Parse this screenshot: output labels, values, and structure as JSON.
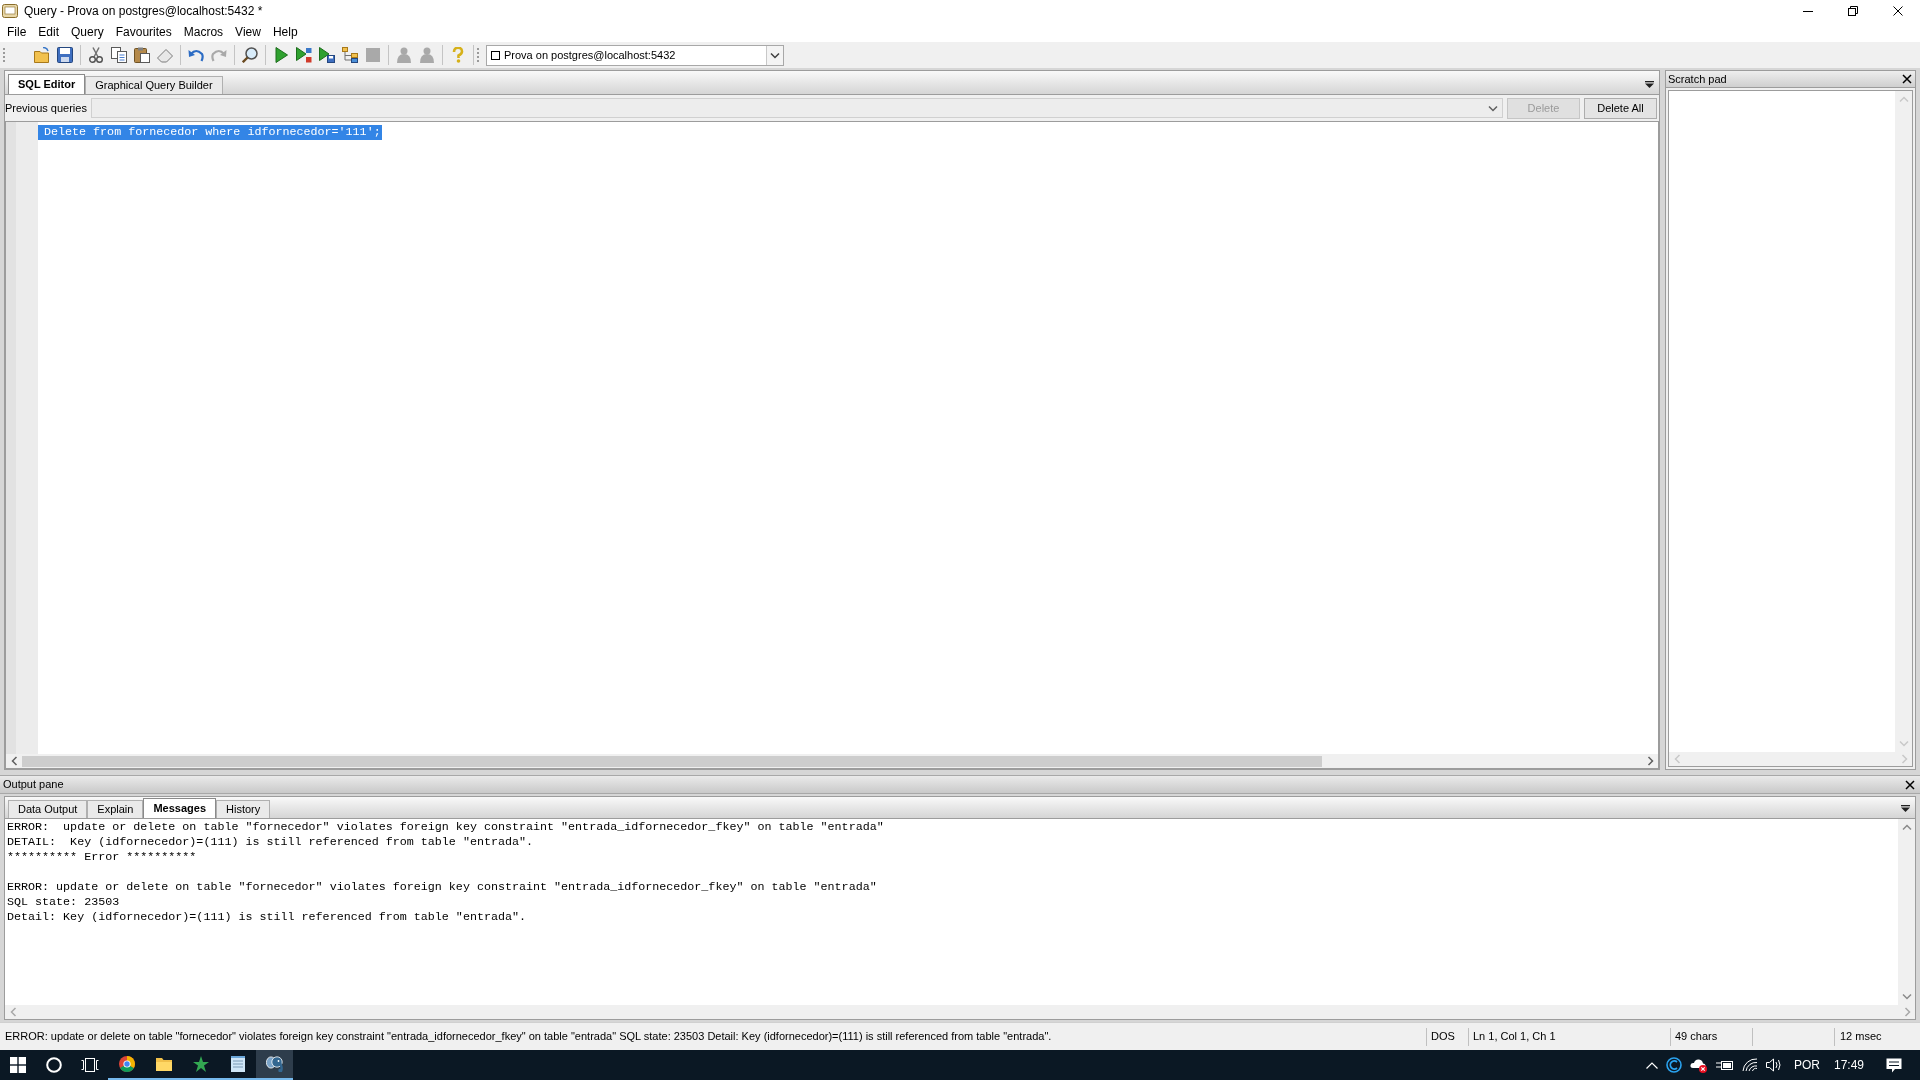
{
  "window": {
    "title": "Query - Prova on postgres@localhost:5432 *"
  },
  "menu": [
    "File",
    "Edit",
    "Query",
    "Favourites",
    "Macros",
    "View",
    "Help"
  ],
  "toolbar": {
    "groups": [
      [
        {
          "kind": "open",
          "disabled": false
        },
        {
          "kind": "save",
          "disabled": false
        }
      ],
      [
        {
          "kind": "cut",
          "disabled": false
        },
        {
          "kind": "copy",
          "disabled": false
        },
        {
          "kind": "paste",
          "disabled": false
        },
        {
          "kind": "clear",
          "disabled": false
        }
      ],
      [
        {
          "kind": "undo",
          "disabled": false
        },
        {
          "kind": "redo",
          "disabled": true
        }
      ],
      [
        {
          "kind": "find",
          "disabled": false
        }
      ],
      [
        {
          "kind": "execute",
          "disabled": false
        },
        {
          "kind": "execute_script",
          "disabled": false
        },
        {
          "kind": "execute_file",
          "disabled": false
        },
        {
          "kind": "explain",
          "disabled": false
        },
        {
          "kind": "stop",
          "disabled": true
        }
      ],
      [
        {
          "kind": "commit",
          "disabled": true
        },
        {
          "kind": "rollback",
          "disabled": true
        }
      ],
      [
        {
          "kind": "help",
          "disabled": false
        }
      ]
    ],
    "connection": "Prova on postgres@localhost:5432"
  },
  "editor": {
    "tabs": [
      {
        "label": "SQL Editor",
        "selected": true
      },
      {
        "label": "Graphical Query Builder",
        "selected": false
      }
    ],
    "previous_queries": {
      "label": "Previous queries",
      "buttons": [
        {
          "label": "Delete",
          "disabled": true
        },
        {
          "label": "Delete All",
          "disabled": false
        }
      ]
    },
    "lines": [
      {
        "text": "Delete from fornecedor where idfornecedor='111';",
        "selected": true
      }
    ]
  },
  "scratch_pad": {
    "title": "Scratch pad"
  },
  "output": {
    "title": "Output pane",
    "tabs": [
      {
        "label": "Data Output",
        "selected": false
      },
      {
        "label": "Explain",
        "selected": false
      },
      {
        "label": "Messages",
        "selected": true
      },
      {
        "label": "History",
        "selected": false
      }
    ],
    "messages": [
      [
        "ERROR:  update or delete on table \"fornecedor\" violates foreign key constraint \"entrada_idfornecedor_fkey\" on table \"entrada\"",
        "DETAIL:  Key (idfornecedor)=(111) is still referenced from table \"entrada\".",
        "********** Error **********"
      ],
      [
        "ERROR: update or delete on table \"fornecedor\" violates foreign key constraint \"entrada_idfornecedor_fkey\" on table \"entrada\"",
        "SQL state: 23503",
        "Detail: Key (idfornecedor)=(111) is still referenced from table \"entrada\"."
      ]
    ]
  },
  "status_bar": {
    "message": "ERROR: update or delete on table \"fornecedor\" violates foreign key constraint \"entrada_idfornecedor_fkey\" on table \"entrada\" SQL state: 23503 Detail: Key (idfornecedor)=(111) is still referenced from table \"entrada\".",
    "line_ending": "DOS",
    "position": "Ln 1, Col 1, Ch 1",
    "length": "49 chars",
    "duration": "12 msec"
  },
  "taskbar": {
    "apps": [
      {
        "kind": "browser",
        "running": true,
        "selected": false
      },
      {
        "kind": "folder",
        "running": true,
        "selected": false
      },
      {
        "kind": "star",
        "running": true,
        "selected": false
      },
      {
        "kind": "notepad",
        "running": true,
        "selected": false
      },
      {
        "kind": "elephant",
        "running": true,
        "selected": true
      }
    ],
    "language": "POR",
    "clock": "17:49"
  }
}
